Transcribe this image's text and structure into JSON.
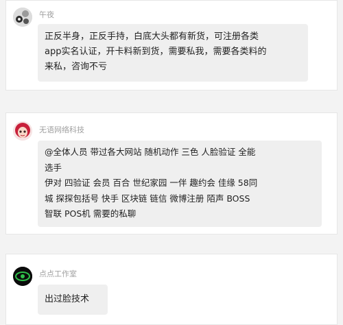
{
  "messages": [
    {
      "sender": "午夜",
      "lines": [
        "正反半身，正反手持，白底大头都有新货，可注册各类",
        "app实名认证，开卡料新到货，需要私我，需要各类料的",
        "来私，咨询不亏"
      ]
    },
    {
      "sender": "无语网络科技",
      "lines": [
        "@全体人员  带过各大网站  随机动作   三色  人脸验证  全能",
        "选手",
        "伊对 四验证  会员   百合 世纪家园  一伴  趣约会      佳缘 58同",
        "城 探探包括号 快手  区块链   链信 微博注册    陌声   BOSS",
        "智联  POS机   需要的私聊"
      ]
    },
    {
      "sender": "点点工作室",
      "lines": [
        "出过脸技术"
      ]
    }
  ],
  "colors": {
    "background": "#f3f3f3",
    "card": "#ffffff",
    "bubble": "#efefef",
    "name": "#a0a0a0",
    "text": "#1f1f1f"
  }
}
